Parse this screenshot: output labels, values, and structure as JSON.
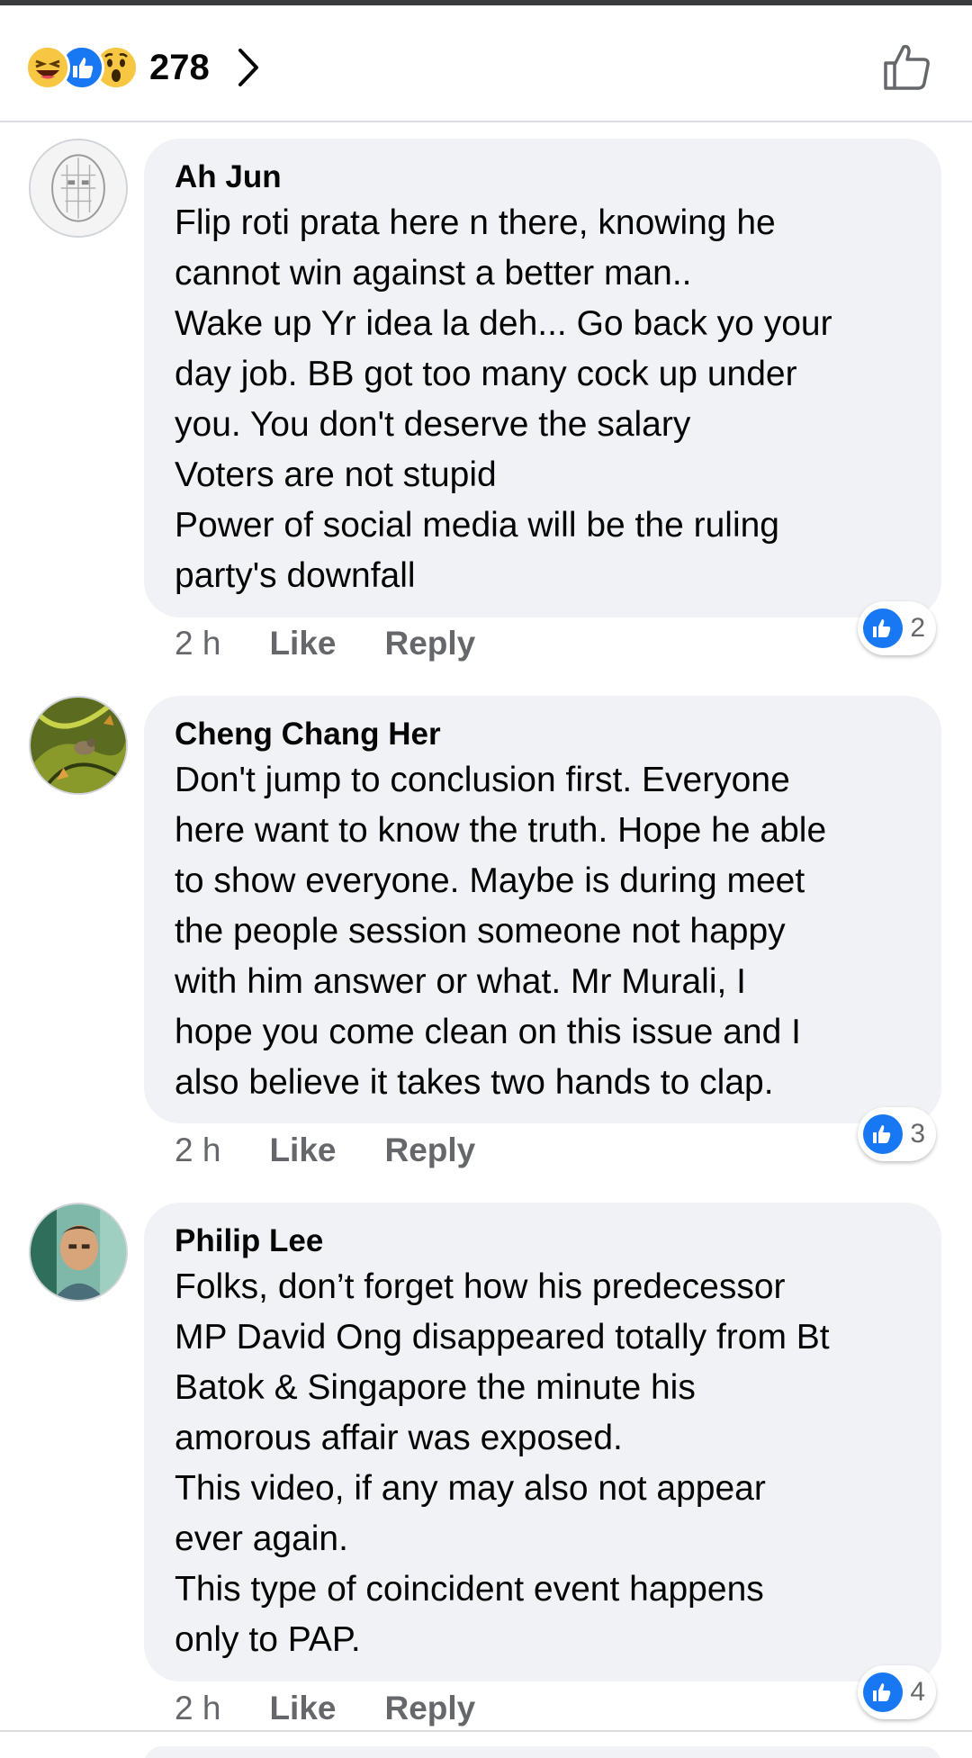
{
  "header": {
    "reaction_count": "278",
    "reaction_icons": [
      "haha-icon",
      "like-icon",
      "wow-icon"
    ]
  },
  "comments": [
    {
      "author": "Ah Jun",
      "lines": [
        "Flip roti prata here n there, knowing he",
        "cannot win against a better man..",
        "Wake up Yr idea la deh... Go back yo your",
        "day job. BB got too many cock up under",
        "you. You don't deserve the salary",
        "Voters are not stupid",
        "Power of social media will be the ruling",
        "party's downfall"
      ],
      "time": "2 h",
      "like_label": "Like",
      "reply_label": "Reply",
      "likes": "2"
    },
    {
      "author": "Cheng Chang Her",
      "lines": [
        "Don't jump to conclusion first. Everyone",
        "here want to know the truth. Hope he able",
        "to show everyone. Maybe is during meet",
        "the people session someone not happy",
        "with him answer or what. Mr Murali, I",
        "hope you come clean on this issue and I",
        "also believe it takes two hands to clap."
      ],
      "time": "2 h",
      "like_label": "Like",
      "reply_label": "Reply",
      "likes": "3"
    },
    {
      "author": "Philip Lee",
      "lines": [
        "Folks, don’t forget how his predecessor",
        "MP David Ong disappeared totally from Bt",
        "Batok & Singapore  the minute his",
        "amorous affair was exposed.",
        "This video, if any may also not appear",
        "ever again.",
        "This type of coincident event happens",
        "only to PAP."
      ],
      "time": "2 h",
      "like_label": "Like",
      "reply_label": "Reply",
      "likes": "4"
    }
  ],
  "colors": {
    "bubble": "#f0f2f5",
    "accent": "#1877f2",
    "muted_text": "#65676b"
  }
}
